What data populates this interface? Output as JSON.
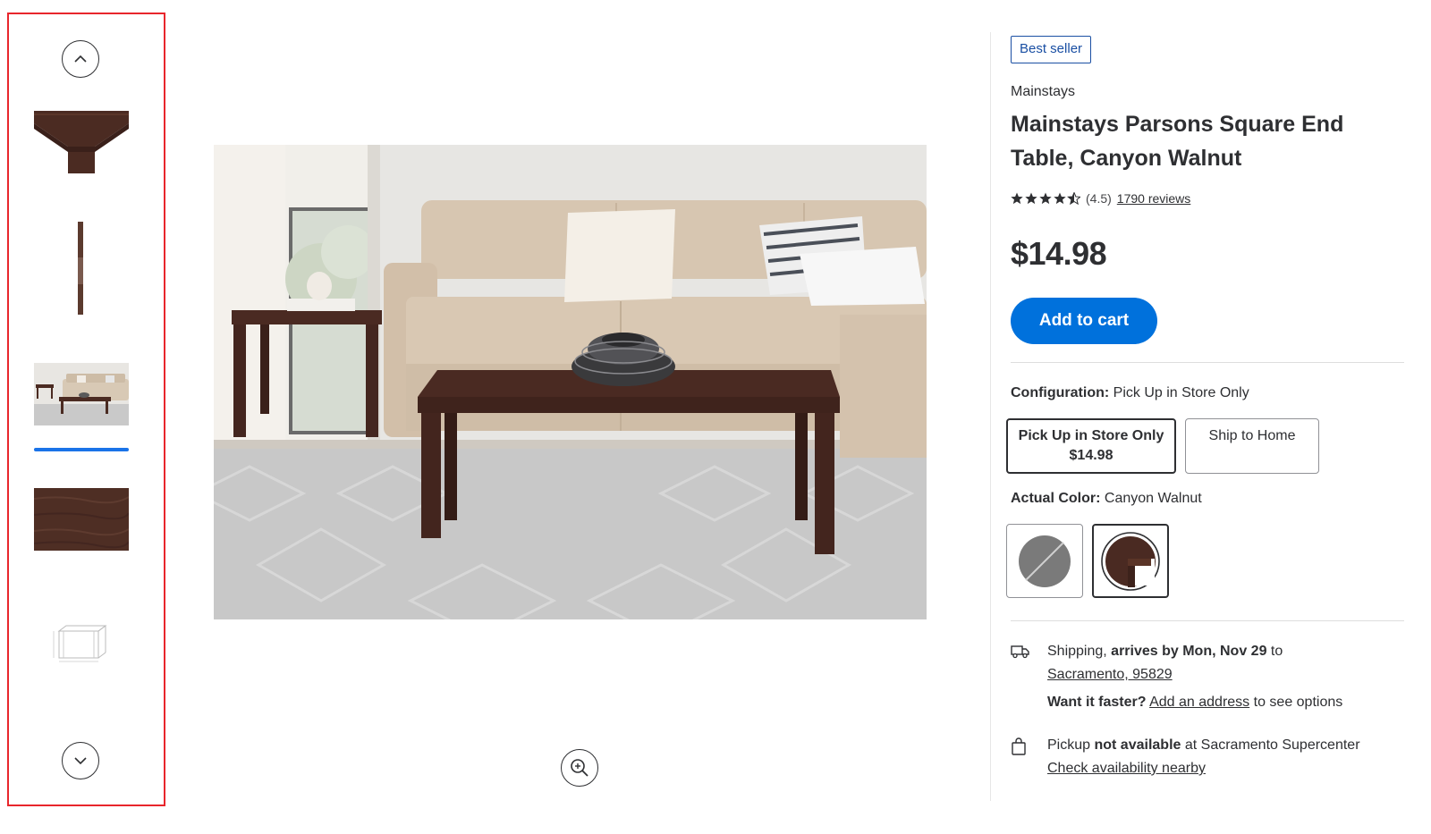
{
  "thumbnails": {
    "scroll_up": "chevron-up-icon",
    "scroll_down": "chevron-down-icon",
    "items": [
      "table corner",
      "table leg side view",
      "living room scene",
      "walnut wood texture",
      "dimension diagram"
    ],
    "selected_index": 2,
    "frame_color": "#e8262c",
    "indicator_color": "#1a73e8"
  },
  "main_image": {
    "zoom_icon": "zoom-in-icon"
  },
  "product": {
    "badge": "Best seller",
    "brand": "Mainstays",
    "title": "Mainstays Parsons Square End Table, Canyon Walnut",
    "rating_value": "(4.5)",
    "rating_stars": 4.5,
    "reviews": "1790 reviews",
    "price": "$14.98",
    "add_to_cart": "Add to cart",
    "accent_color": "#0071dc"
  },
  "configuration": {
    "label": "Configuration:",
    "value": "Pick Up in Store Only",
    "options": [
      {
        "label": "Pick Up in Store Only",
        "price": "$14.98",
        "selected": true
      },
      {
        "label": "Ship to Home",
        "price": "",
        "selected": false
      }
    ]
  },
  "color": {
    "label": "Actual Color:",
    "value": "Canyon Walnut",
    "swatches": [
      {
        "name": "gray",
        "hex": "#7a7a7a",
        "available": false,
        "selected": false
      },
      {
        "name": "Canyon Walnut",
        "hex": "#4a2a22",
        "available": true,
        "selected": true
      }
    ]
  },
  "shipping": {
    "prefix": "Shipping,",
    "arrives": "arrives by Mon, Nov 29",
    "to": "to",
    "location": "Sacramento, 95829",
    "faster_q": "Want it faster?",
    "add_address": "Add an address",
    "see_options": "to see options"
  },
  "pickup": {
    "prefix": "Pickup",
    "status": "not available",
    "at": "at Sacramento Supercenter",
    "check": "Check availability nearby"
  }
}
